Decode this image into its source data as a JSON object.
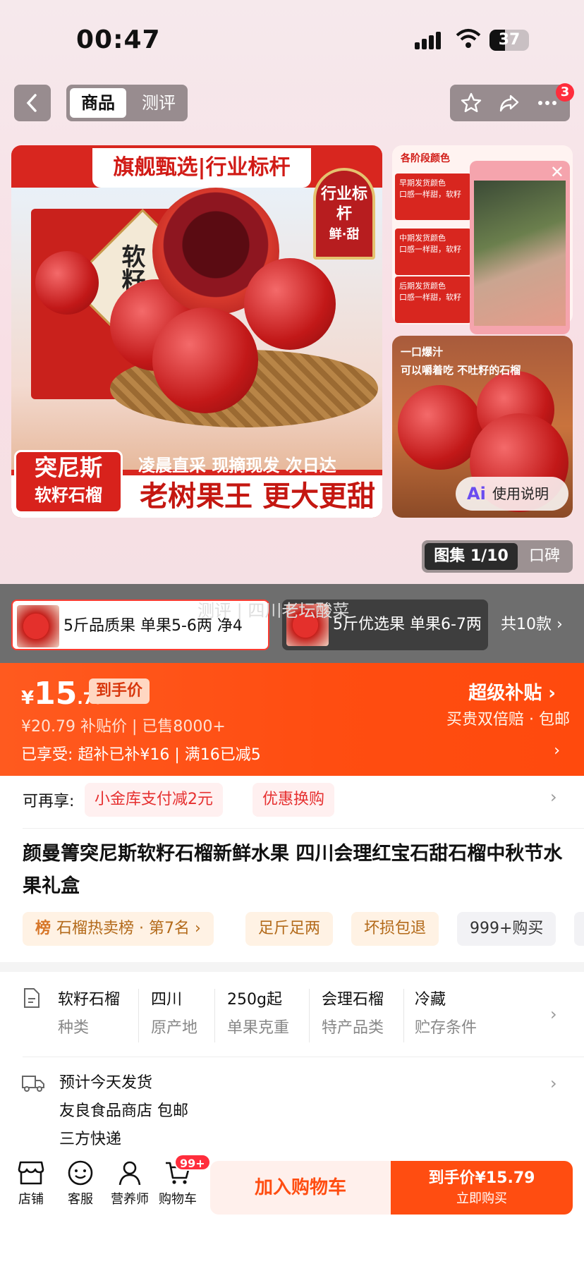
{
  "status_bar": {
    "time": "00:47",
    "battery": "37"
  },
  "nav": {
    "tab_goods": "商品",
    "tab_review": "测评",
    "badge_count": "3"
  },
  "main_image": {
    "banner": "旗舰甄选|行业标杆",
    "box_text": "软籽",
    "award": "行业标杆",
    "award_sub": "鲜·甜",
    "tag_line1": "突尼斯",
    "tag_line2": "软籽石榴",
    "strip": "凌晨直采 现摘现发 次日达",
    "bottom": "老树果王 更大更甜"
  },
  "thumb_top": {
    "title": "各阶段颜色",
    "phases": [
      "早期发货颜色\n口感一样甜，软籽",
      "中期发货颜色\n口感一样甜，软籽",
      "后期发货颜色\n口感一样甜，软籽"
    ]
  },
  "thumb_bottom": {
    "line1": "一口爆汁",
    "line2": "可以嚼着吃 不吐籽的石榴",
    "usage_ai": "Ai",
    "usage_label": "使用说明"
  },
  "gallery": {
    "active": "图集 1/10",
    "koubei": "口碑"
  },
  "sku": {
    "watermark": "测评 | 四川老坛酸菜",
    "option1": "5斤品质果 单果5-6两 净4",
    "option2": "5斤优选果 单果6-7两",
    "more": "共10款 ›"
  },
  "price": {
    "yen": "¥",
    "int": "15",
    "dec": ".79",
    "tag": "到手价",
    "line2": "¥20.79  补贴价 | 已售8000+",
    "line3": "已享受: 超补已补¥16 | 满16已减5",
    "super_sub": "超级补贴 ›",
    "super_sub2": "买贵双倍赔 · 包邮",
    "chevron": "›"
  },
  "offers": {
    "label": "可再享:",
    "offer1": "小金库支付减2元",
    "offer2": "优惠换购",
    "chevron": "›"
  },
  "title": "颜曼箐突尼斯软籽石榴新鲜水果 四川会理红宝石甜石榴中秋节水果礼盒",
  "tags": {
    "rank_prefix": "榜",
    "rank": "石榴热卖榜 · 第7名 ›",
    "tag2": "足斤足两",
    "tag3": "坏损包退",
    "tag4": "999+购买"
  },
  "attributes": [
    {
      "value": "软籽石榴",
      "key": "种类"
    },
    {
      "value": "四川",
      "key": "原产地"
    },
    {
      "value": "250g起",
      "key": "单果克重"
    },
    {
      "value": "会理石榴",
      "key": "特产品类"
    },
    {
      "value": "冷藏",
      "key": "贮存条件"
    }
  ],
  "shipping": {
    "line1": "预计今天发货",
    "line2": "友良食品商店  包邮",
    "line3": "三方快递",
    "chevron": "›"
  },
  "bottom_bar": {
    "shop": "店铺",
    "service": "客服",
    "nutritionist": "营养师",
    "cart": "购物车",
    "cart_badge": "99+",
    "add_cart": "加入购物车",
    "buy_line1": "到手价¥15.79",
    "buy_line2": "立即购买"
  },
  "colors": {
    "accent": "#ff4d11",
    "badge": "#ff2d3c"
  }
}
